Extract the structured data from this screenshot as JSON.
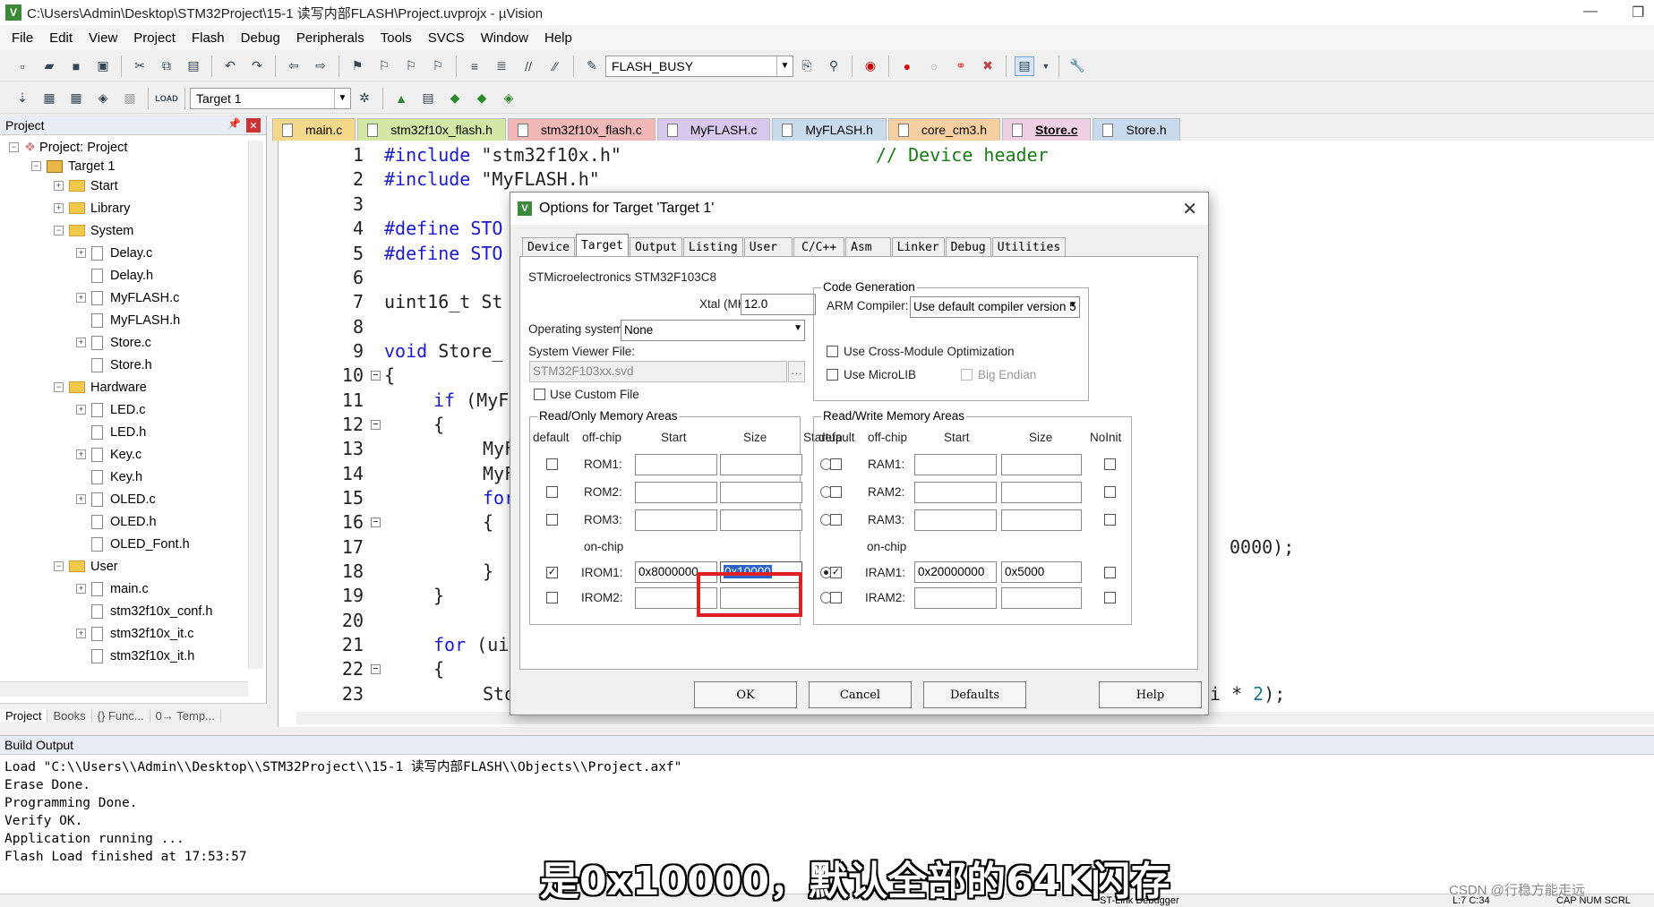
{
  "window": {
    "title": "C:\\Users\\Admin\\Desktop\\STM32Project\\15-1 读写内部FLASH\\Project.uvprojx - µVision",
    "icon": "V"
  },
  "menu": [
    "File",
    "Edit",
    "View",
    "Project",
    "Flash",
    "Debug",
    "Peripherals",
    "Tools",
    "SVCS",
    "Window",
    "Help"
  ],
  "toolbar": {
    "find_combo": "FLASH_BUSY",
    "target_combo": "Target 1"
  },
  "project_panel": {
    "title": "Project",
    "root": "Project: Project",
    "target": "Target 1",
    "groups": {
      "start": "Start",
      "library": "Library",
      "system": "System",
      "hardware": "Hardware",
      "user": "User"
    },
    "files": {
      "delay_c": "Delay.c",
      "delay_h": "Delay.h",
      "myflash_c": "MyFLASH.c",
      "myflash_h": "MyFLASH.h",
      "store_c": "Store.c",
      "store_h": "Store.h",
      "led_c": "LED.c",
      "led_h": "LED.h",
      "key_c": "Key.c",
      "key_h": "Key.h",
      "oled_c": "OLED.c",
      "oled_h": "OLED.h",
      "oled_font": "OLED_Font.h",
      "main_c": "main.c",
      "conf_h": "stm32f10x_conf.h",
      "it_c": "stm32f10x_it.c",
      "it_h": "stm32f10x_it.h"
    },
    "tabs": [
      "Project",
      "Books",
      "{} Func...",
      "0→ Temp..."
    ]
  },
  "editor_tabs": [
    {
      "label": "main.c",
      "color": "#f5d98a"
    },
    {
      "label": "stm32f10x_flash.h",
      "color": "#d4e8a6"
    },
    {
      "label": "stm32f10x_flash.c",
      "color": "#f2b8b8"
    },
    {
      "label": "MyFLASH.c",
      "color": "#d8c8ee"
    },
    {
      "label": "MyFLASH.h",
      "color": "#c8dcee"
    },
    {
      "label": "core_cm3.h",
      "color": "#f5cfa0"
    },
    {
      "label": "Store.c",
      "color": "#eed0e2"
    },
    {
      "label": "Store.h",
      "color": "#c9d9ee"
    }
  ],
  "code": {
    "l1a": "#include ",
    "l1b": "\"stm32f10x.h\"",
    "l1c": "// Device header",
    "l2a": "#include ",
    "l2b": "\"MyFLASH.h\"",
    "l4": "#define STO",
    "l5": "#define STO",
    "l7": "uint16_t St",
    "l9a": "void",
    "l9b": " Store_",
    "l10": "{",
    "l11a": "if",
    "l11b": " (MyF",
    "l12": "{",
    "l13": "MyF",
    "l14": "MyF",
    "l15": "for",
    "l16": "{",
    "l17": "0000);",
    "l18": "}",
    "l19": "}",
    "l21a": "for",
    "l21b": " (ui",
    "l22": "{",
    "l23a": "Sto",
    "l23b": "i * ",
    "l23c": "2",
    "l23d": ");"
  },
  "build_output": {
    "title": "Build Output",
    "lines": [
      "Load \"C:\\\\Users\\\\Admin\\\\Desktop\\\\STM32Project\\\\15-1 读写内部FLASH\\\\Objects\\\\Project.axf\"",
      "Erase Done.",
      "Programming Done.",
      "Verify OK.",
      "Application running ...",
      "Flash Load finished at 17:53:57"
    ]
  },
  "status": {
    "debugger": "ST-Link Debugger",
    "pos": "L:7 C:34",
    "caps": "CAP NUM SCRL"
  },
  "subtitle": "是0x10000，默认全部的64K闪存",
  "watermark": "CSDN @行稳方能走远",
  "dialog": {
    "title": "Options for Target 'Target 1'",
    "tabs": [
      "Device",
      "Target",
      "Output",
      "Listing",
      "User",
      "C/C++",
      "Asm",
      "Linker",
      "Debug",
      "Utilities"
    ],
    "device": "STMicroelectronics STM32F103C8",
    "xtal_label": "Xtal (MHz):",
    "xtal": "12.0",
    "os_label": "Operating system:",
    "os": "None",
    "svf_label": "System Viewer File:",
    "svf": "STM32F103xx.svd",
    "custom_file": "Use Custom File",
    "codegen": "Code Generation",
    "arm_label": "ARM Compiler:",
    "arm": "Use default compiler version 5",
    "cross": "Use Cross-Module Optimization",
    "microlib": "Use MicroLIB",
    "bigendian": "Big Endian",
    "ro_title": "Read/Only Memory Areas",
    "rw_title": "Read/Write Memory Areas",
    "h_default": "default",
    "h_offchip": "off-chip",
    "h_start": "Start",
    "h_size": "Size",
    "h_startup": "Startup",
    "h_noinit": "NoInit",
    "onchip": "on-chip",
    "rom1": "ROM1:",
    "rom2": "ROM2:",
    "rom3": "ROM3:",
    "irom1": "IROM1:",
    "irom2": "IROM2:",
    "irom1_start": "0x8000000",
    "irom1_size": "0x10000",
    "ram1": "RAM1:",
    "ram2": "RAM2:",
    "ram3": "RAM3:",
    "iram1": "IRAM1:",
    "iram2": "IRAM2:",
    "iram1_start": "0x20000000",
    "iram1_size": "0x5000",
    "ok": "OK",
    "cancel": "Cancel",
    "defaults": "Defaults",
    "help": "Help"
  }
}
